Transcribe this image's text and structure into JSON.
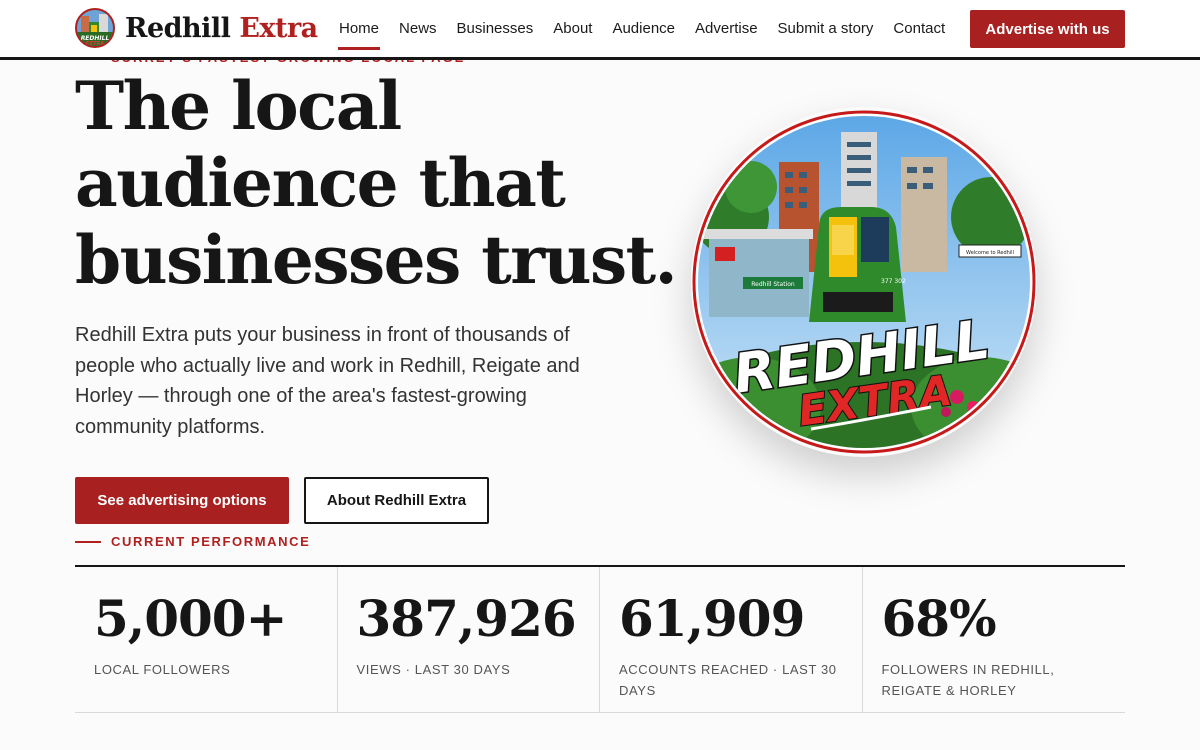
{
  "brand": {
    "name_main": "Redhill",
    "name_accent": "Extra",
    "badge_icon": "redhill-extra-logo-icon"
  },
  "nav": {
    "items": [
      {
        "label": "Home",
        "active": true
      },
      {
        "label": "News"
      },
      {
        "label": "Businesses"
      },
      {
        "label": "About"
      },
      {
        "label": "Audience"
      },
      {
        "label": "Advertise"
      },
      {
        "label": "Submit a story"
      },
      {
        "label": "Contact"
      }
    ],
    "cta_label": "Advertise with us"
  },
  "hero": {
    "eyebrow_clipped": "SURREY'S FASTEST-GROWING LOCAL PAGE",
    "headline_lines": [
      "The local",
      "audience that",
      "businesses trust."
    ],
    "lede": "Redhill Extra puts your business in front of thousands of people who actually live and work in Redhill, Reigate and Horley — through one of the area's fastest-growing community platforms.",
    "primary_button": "See advertising options",
    "secondary_button": "About Redhill Extra",
    "badge": {
      "title_line1": "REDHILL",
      "title_line2": "EXTRA",
      "station_sign": "Redhill Station",
      "welcome_sign": "Welcome to Redhill",
      "train_number": "377 302"
    }
  },
  "performance": {
    "eyebrow": "CURRENT PERFORMANCE",
    "stats": [
      {
        "value": "5,000+",
        "label": "Local followers"
      },
      {
        "value": "387,926",
        "label": "Views · last 30 days"
      },
      {
        "value": "61,909",
        "label": "Accounts reached · last 30 days"
      },
      {
        "value": "68%",
        "label": "Followers in Redhill, Reigate & Horley"
      }
    ]
  },
  "colors": {
    "accent": "#a8201f",
    "ink": "#161616",
    "train_green": "#2f8a2b",
    "train_yellow": "#f4c20d"
  }
}
